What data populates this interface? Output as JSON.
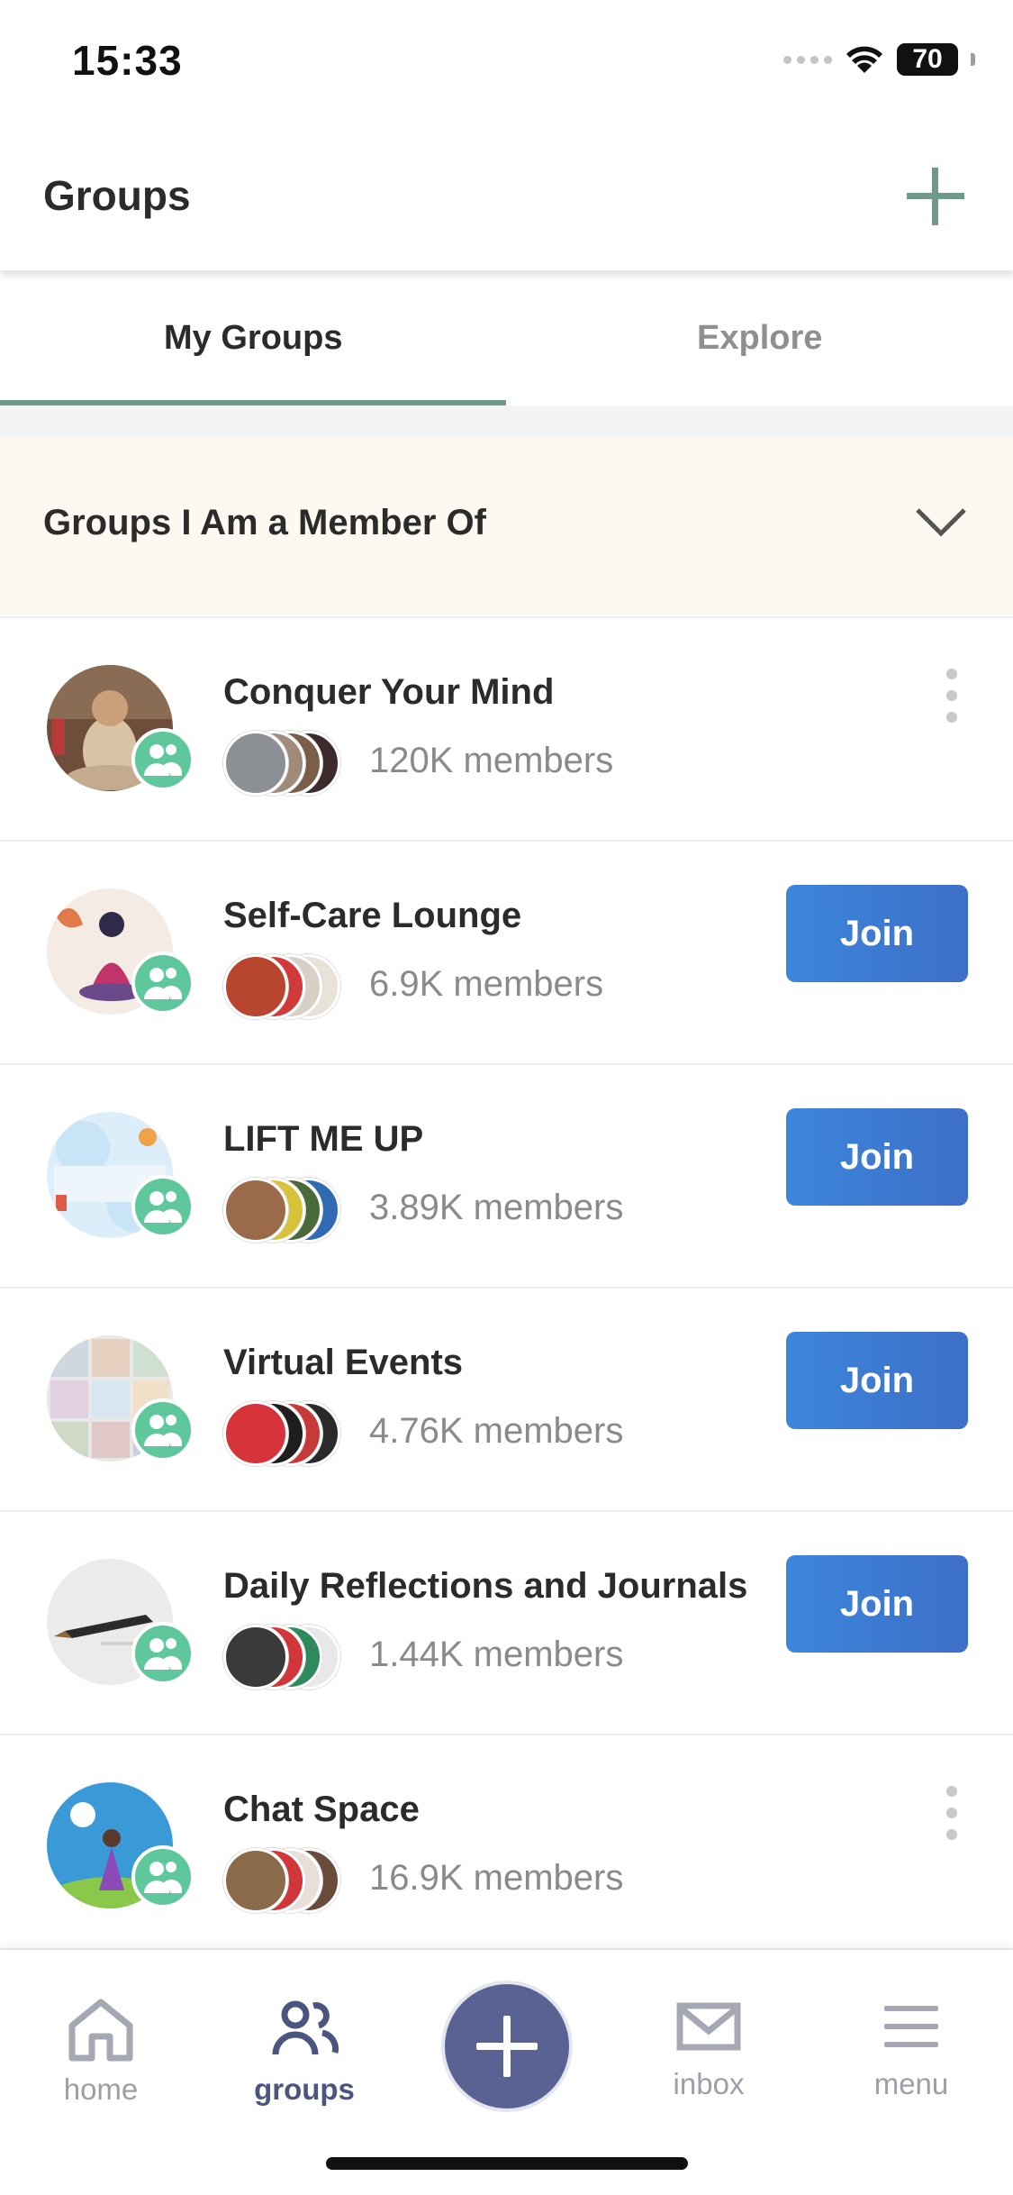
{
  "status_bar": {
    "time": "15:33",
    "battery": "70"
  },
  "header": {
    "title": "Groups",
    "add_icon": "plus-icon"
  },
  "tabs": [
    {
      "label": "My Groups",
      "active": true
    },
    {
      "label": "Explore",
      "active": false
    }
  ],
  "section": {
    "title": "Groups I Am a Member Of",
    "icon": "chevron-down-icon"
  },
  "groups": [
    {
      "name": "Conquer Your Mind",
      "members": "120K members",
      "action": "more"
    },
    {
      "name": "Self-Care Lounge",
      "members": "6.9K members",
      "action": "join",
      "join_label": "Join"
    },
    {
      "name": "LIFT ME UP",
      "members": "3.89K members",
      "action": "join",
      "join_label": "Join"
    },
    {
      "name": "Virtual Events",
      "members": "4.76K members",
      "action": "join",
      "join_label": "Join"
    },
    {
      "name": "Daily Reflections and Journals",
      "members": "1.44K members",
      "action": "join",
      "join_label": "Join"
    },
    {
      "name": "Chat Space",
      "members": "16.9K members",
      "action": "more"
    }
  ],
  "bottom_nav": {
    "items": [
      {
        "label": "home",
        "icon": "home-icon",
        "active": false
      },
      {
        "label": "groups",
        "icon": "groups-icon",
        "active": true
      },
      {
        "label": "inbox",
        "icon": "inbox-icon",
        "active": false
      },
      {
        "label": "menu",
        "icon": "menu-icon",
        "active": false
      }
    ],
    "create_icon": "plus-icon"
  },
  "colors": {
    "accent_green": "#6f9a88",
    "join_blue": "#3d7ad4",
    "badge_green": "#5ec79b",
    "nav_active": "#4b5680",
    "section_bg": "#fdf9f1"
  }
}
